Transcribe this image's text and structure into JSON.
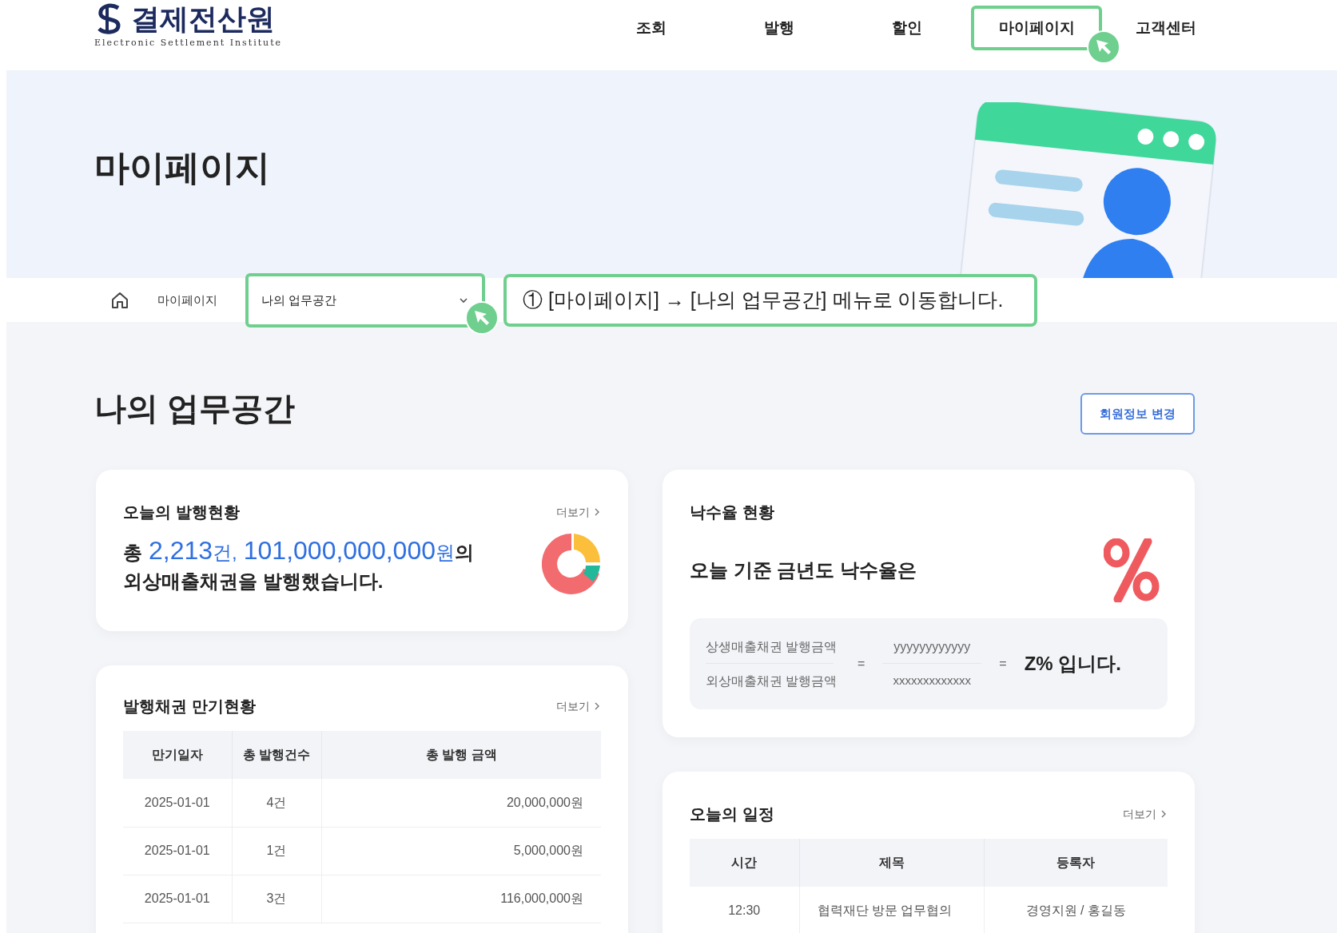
{
  "header": {
    "logo_title": "결제전산원",
    "logo_subtitle": "Electronic Settlement Institute",
    "nav": [
      {
        "label": "조회",
        "highlighted": false
      },
      {
        "label": "발행",
        "highlighted": false
      },
      {
        "label": "할인",
        "highlighted": false
      },
      {
        "label": "마이페이지",
        "highlighted": true
      },
      {
        "label": "고객센터",
        "highlighted": false
      }
    ]
  },
  "hero": {
    "title": "마이페이지"
  },
  "breadcrumb": {
    "current": "마이페이지",
    "select": {
      "value": "나의 업무공간",
      "highlighted": true
    }
  },
  "annotation": "① [마이페이지] → [나의 업무공간] 메뉴로 이동합니다.",
  "section": {
    "title": "나의 업무공간",
    "button": "회원정보 변경"
  },
  "issuance_card": {
    "title": "오늘의 발행현황",
    "more": "더보기",
    "summary": [
      {
        "text": "총",
        "kind": "plain"
      },
      {
        "text": "2,213",
        "kind": "number"
      },
      {
        "text": "건,",
        "kind": "unit"
      },
      {
        "text": "101,000,000,000",
        "kind": "number"
      },
      {
        "text": "원",
        "kind": "unit"
      },
      {
        "text": "의",
        "kind": "plain"
      }
    ],
    "summary_line2": "외상매출채권을 발행했습니다."
  },
  "rate_card": {
    "title": "낙수율 현황",
    "lead": "오늘 기준 금년도 낙수율은",
    "numerator_label": "상생매출채권 발행금액",
    "denominator_label": "외상매출채권 발행금액",
    "equals_1": "=",
    "numerator": "yyyyyyyyyyyy",
    "denominator": "xxxxxxxxxxxxx",
    "equals_2": "=",
    "result": "Z% 입니다."
  },
  "maturity_card": {
    "title": "발행채권 만기현황",
    "more": "더보기",
    "columns": [
      "만기일자",
      "총 발행건수",
      "총 발행 금액"
    ],
    "rows": [
      [
        "2025-01-01",
        "4건",
        "20,000,000원"
      ],
      [
        "2025-01-01",
        "1건",
        "5,000,000원"
      ],
      [
        "2025-01-01",
        "3건",
        "116,000,000원"
      ]
    ]
  },
  "schedule_card": {
    "title": "오늘의 일정",
    "more": "더보기",
    "columns": [
      "시간",
      "제목",
      "등록자"
    ],
    "rows": [
      [
        "12:30",
        "협력재단 방문 업무협의",
        "경영지원 / 홍길동"
      ]
    ]
  }
}
